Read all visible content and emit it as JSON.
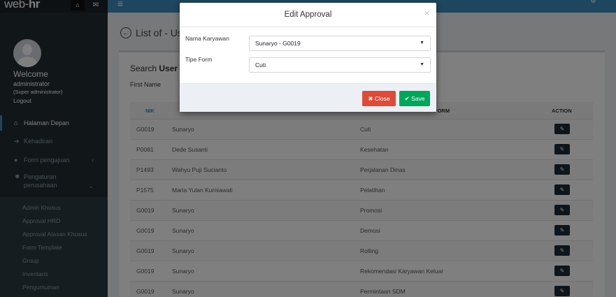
{
  "header": {
    "logo_main": "web-",
    "logo_accent": "hr",
    "home_icon": "home-icon",
    "mail_icon": "mail-icon",
    "menu_icon": "hamburger-icon",
    "gear_icon": "gear-icon"
  },
  "user": {
    "welcome": "Welcome",
    "role": "administrator",
    "role_detail": "(Super administrator)",
    "logout": "Logout"
  },
  "sidebar": {
    "items": [
      {
        "label": "Halaman Depan",
        "icon": "home-icon",
        "active": true
      },
      {
        "label": "Kehadiran",
        "icon": "sign-in-icon"
      },
      {
        "label": "Form pengajuan",
        "icon": "circle-icon"
      },
      {
        "label_line1": "Pengaturan",
        "label_line2": "perusahaan",
        "icon": "users-icon"
      }
    ],
    "submenu": [
      "Admin Khusus",
      "Approval HRD",
      "Approval Atasan Khusus",
      "Form Template",
      "Group",
      "Inventaris",
      "Pengumuman"
    ]
  },
  "page": {
    "title": "List of - Us",
    "search_title_prefix": "Search ",
    "search_title_bold": "User",
    "first_name_label": "First Name"
  },
  "table": {
    "headers": {
      "nik": "NIK",
      "form": "FORM",
      "action": "ACTION"
    },
    "rows": [
      {
        "nik": "G0019",
        "name": "Sunaryo",
        "form": "Cuti"
      },
      {
        "nik": "P0081",
        "name": "Dede Susanti",
        "form": "Kesehatan"
      },
      {
        "nik": "P1493",
        "name": "Wahyu Puji Sucianto",
        "form": "Perjalanan Dinas"
      },
      {
        "nik": "P1575",
        "name": "Maria Yulan Kurniawati",
        "form": "Pelatihan"
      },
      {
        "nik": "G0019",
        "name": "Sunaryo",
        "form": "Promosi"
      },
      {
        "nik": "G0019",
        "name": "Sunaryo",
        "form": "Demosi"
      },
      {
        "nik": "G0019",
        "name": "Sunaryo",
        "form": "Rolling"
      },
      {
        "nik": "G0019",
        "name": "Sunaryo",
        "form": "Rekomendasi Karyawan Keluar"
      },
      {
        "nik": "G0019",
        "name": "Sunaryo",
        "form": "Permintaan SDM"
      }
    ]
  },
  "modal": {
    "title": "Edit Approval",
    "close_x": "×",
    "employee_label": "Nama Karyawan",
    "employee_value": "Sunaryo - G0019",
    "form_type_label": "Tipe Form",
    "form_type_value": "Cuti",
    "close_button": "Close",
    "save_button": "Save"
  },
  "colors": {
    "sidebar_bg": "#222d32",
    "topbar_bg": "#3c8dbc",
    "close_btn": "#dd4b39",
    "save_btn": "#00a65a",
    "edit_btn": "#1d2b36"
  }
}
